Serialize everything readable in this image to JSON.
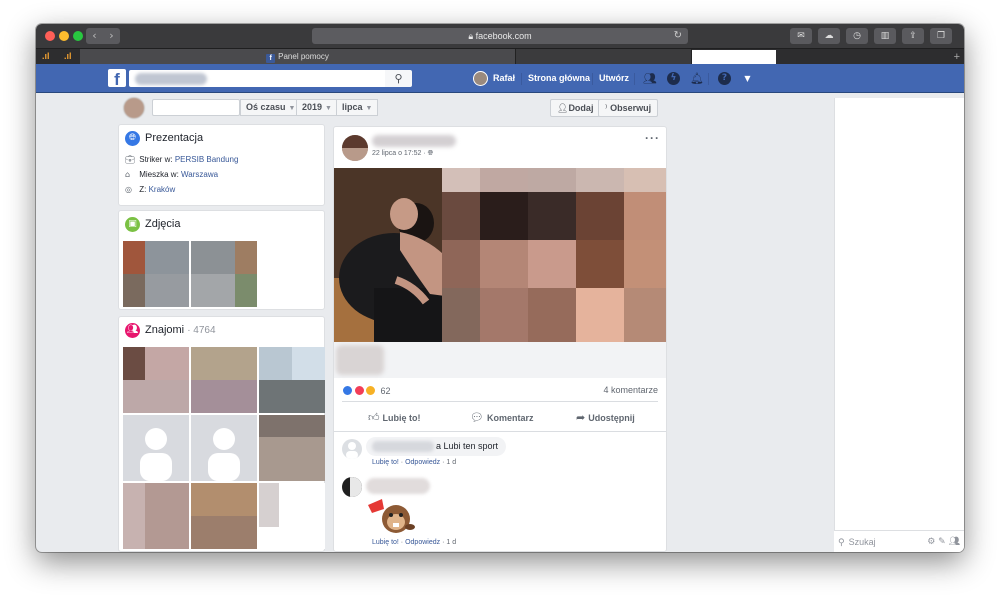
{
  "browser": {
    "url": "facebook.com",
    "tabs": [
      {
        "label": "Panel pomocy"
      },
      {
        "label": ""
      }
    ]
  },
  "fb": {
    "logo": "f",
    "user_name": "Rafał",
    "nav_home": "Strona główna",
    "nav_create": "Utwórz",
    "help": "?"
  },
  "profile_header": {
    "name_value": "",
    "timeline": "Oś czasu",
    "year": "2019",
    "month": "lipca",
    "add_friend": "Dodaj",
    "follow": "Obserwuj"
  },
  "intro": {
    "title": "Prezentacja",
    "work_prefix": "Striker w:",
    "work_value": "PERSIB Bandung",
    "lives_prefix": "Mieszka w:",
    "lives_value": "Warszawa",
    "from_prefix": "Z:",
    "from_value": "Kraków"
  },
  "photos": {
    "title": "Zdjęcia"
  },
  "friends": {
    "title": "Znajomi",
    "count": "· 4764"
  },
  "post": {
    "time": "22 lipca o 17:52 ·",
    "more": "···",
    "reaction_count": "62",
    "comments_count": "4 komentarze",
    "like": "Lubię to!",
    "comment": "Komentarz",
    "share": "Udostępnij",
    "comments": [
      {
        "text": "a Lubi ten sport",
        "like": "Lubię to!",
        "reply": "Odpowiedz",
        "age": "· 1 d"
      },
      {
        "text": "",
        "like": "Lubię to!",
        "reply": "Odpowiedz",
        "age": "· 1 d"
      }
    ]
  },
  "chat": {
    "search_placeholder": "Szukaj"
  },
  "colors": {
    "fb_blue": "#4267b2",
    "link": "#385898",
    "page_bg": "#e9ebee"
  },
  "icons": {
    "search": "search-icon",
    "friends": "friends-icon",
    "messenger": "messenger-icon",
    "notifications": "bell-icon",
    "help": "help-icon"
  }
}
